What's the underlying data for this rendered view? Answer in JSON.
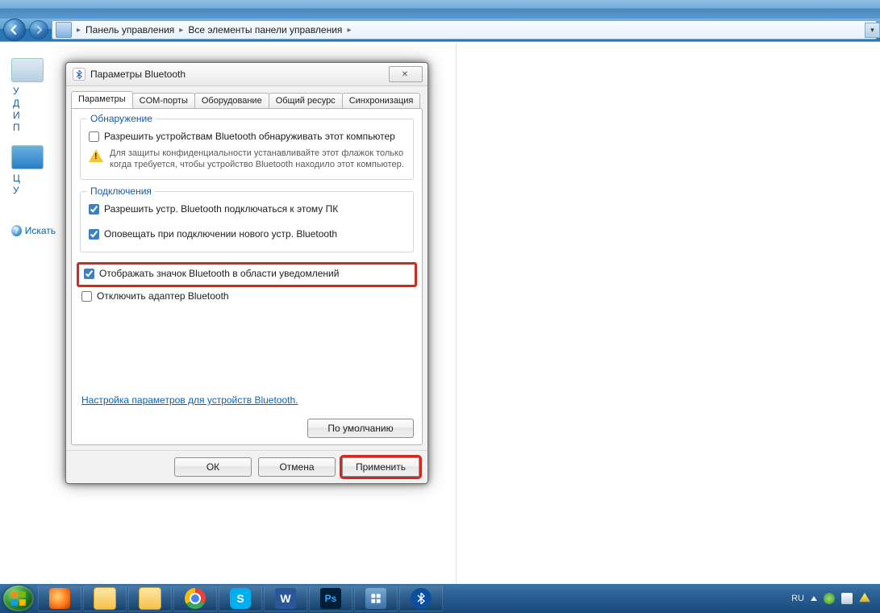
{
  "breadcrumb": {
    "item1": "Панель управления",
    "item2": "Все элементы панели управления"
  },
  "sidebar": {
    "l1": "У",
    "l2": "Д",
    "l3": "И",
    "l4": "П",
    "l5": "Ц",
    "l6": "У",
    "search_hint": "Искать"
  },
  "dialog": {
    "title": "Параметры Bluetooth",
    "close_glyph": "✕",
    "tabs": {
      "t1": "Параметры",
      "t2": "COM-порты",
      "t3": "Оборудование",
      "t4": "Общий ресурс",
      "t5": "Синхронизация"
    },
    "group_discovery": {
      "legend": "Обнаружение",
      "allow_label": "Разрешить устройствам Bluetooth обнаруживать этот компьютер",
      "warn": "Для защиты конфиденциальности устанавливайте этот флажок только когда требуется, чтобы устройство Bluetooth находило этот компьютер."
    },
    "group_conn": {
      "legend": "Подключения",
      "c1": "Разрешить устр. Bluetooth подключаться к этому ПК",
      "c2": "Оповещать при подключении нового устр. Bluetooth"
    },
    "show_icon": "Отображать значок Bluetooth в области уведомлений",
    "disable_adapter": "Отключить адаптер Bluetooth",
    "link": "Настройка параметров для устройств Bluetooth.",
    "defaults": "По умолчанию",
    "ok": "ОК",
    "cancel": "Отмена",
    "apply": "Применить"
  },
  "taskbar": {
    "lang": "RU"
  }
}
